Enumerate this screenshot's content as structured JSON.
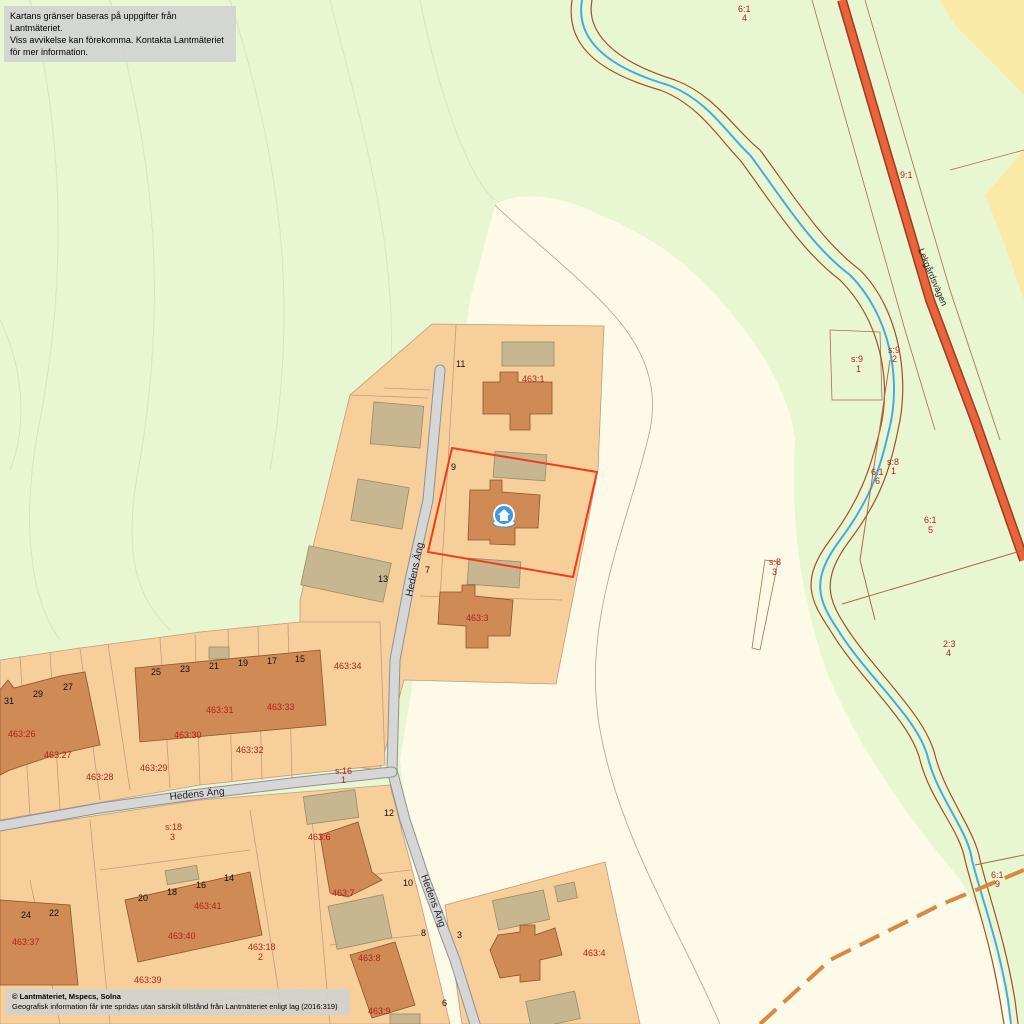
{
  "notice": {
    "line1": "Kartans gränser baseras på uppgifter från Lantmäteriet.",
    "line2": "Viss avvikelse kan förekomma. Kontakta Lantmäteriet för mer information."
  },
  "copyright": {
    "line1": "© Lantmäteriet, Mspecs, Solna",
    "line2": "Geografisk information får inte spridas utan särskilt tillstånd från Lantmäteriet enligt lag (2016:319)"
  },
  "streets": {
    "hedens_ang_north": "Hedens Äng",
    "hedens_ang_west": "Hedens Äng",
    "hedens_ang_south": "Hedens Äng",
    "lekvagen": "Lekgårdsvägen"
  },
  "parcels": {
    "p463_1": "463:1",
    "p463_3": "463:3",
    "p463_4": "463:4",
    "p463_6": "463:6",
    "p463_7": "463:7",
    "p463_8": "463:8",
    "p463_9": "463:9",
    "p463_18a": "463:18",
    "p463_18b": "2",
    "p463_26": "463:26",
    "p463_27": "463:27",
    "p463_28": "463:28",
    "p463_29": "463:29",
    "p463_30": "463:30",
    "p463_31": "463:31",
    "p463_32": "463:32",
    "p463_33": "463:33",
    "p463_34": "463:34",
    "p463_37": "463:37",
    "p463_39": "463:39",
    "p463_40": "463:40",
    "p463_41": "463:41",
    "s16a": "s:16",
    "s16b": "1",
    "s18a": "s:18",
    "s18b": "3",
    "s8a": "s:8",
    "s8b": "3",
    "s9a": "s:9",
    "s9b": "1",
    "s9ba": "s:9",
    "s9bb": "2",
    "s8ca": "s:8",
    "s8cb": "1",
    "e61a": "6:1",
    "e61b": "4",
    "e91": "9:1",
    "e61ca": "6:1",
    "e61cb": "6",
    "e61da": "6:1",
    "e61db": "5",
    "e23a": "2:3",
    "e23b": "4",
    "e61ea": "6:1",
    "e61eb": "9"
  },
  "house_numbers": {
    "n11": "11",
    "n9": "9",
    "n7": "7",
    "n13": "13",
    "n31": "31",
    "n29": "29",
    "n27": "27",
    "n25": "25",
    "n23": "23",
    "n21": "21",
    "n19": "19",
    "n17": "17",
    "n15": "15",
    "n12": "12",
    "n10": "10",
    "n8": "8",
    "n6": "6",
    "n3": "3",
    "n24": "24",
    "n22": "22",
    "n20": "20",
    "n18": "18",
    "n16": "16",
    "n14": "14"
  },
  "colors": {
    "forest": "#e8f7d2",
    "open_land": "#fdfbe8",
    "residential": "#f6cf9a",
    "building": "#cf8a55",
    "outbuilding": "#c8b690",
    "road": "#d6d6d6",
    "main_road": "#e8643c",
    "stream": "#4aa8e0",
    "highlight": "#f03c1e",
    "boundary": "#b06a4a"
  },
  "marker": {
    "icon": "home-marker-icon"
  }
}
